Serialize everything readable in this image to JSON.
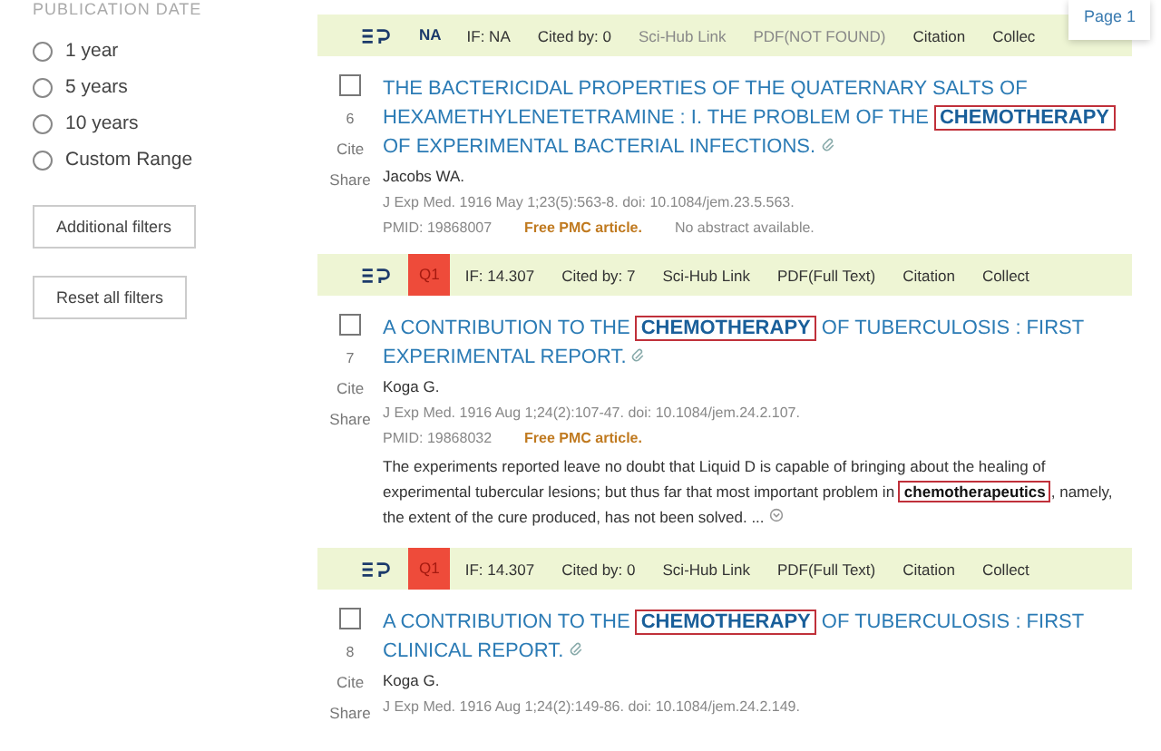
{
  "sidebar": {
    "section_title": "PUBLICATION DATE",
    "date_options": [
      {
        "label": "1 year",
        "selected": false
      },
      {
        "label": "5 years",
        "selected": false
      },
      {
        "label": "10 years",
        "selected": false
      },
      {
        "label": "Custom Range",
        "selected": false
      }
    ],
    "buttons": [
      "Additional filters",
      "Reset all filters"
    ]
  },
  "page_tag": "Page 1",
  "results": [
    {
      "toolbar": {
        "quartile": {
          "text": "NA",
          "kind": "plain"
        },
        "items": [
          {
            "text": "IF: NA",
            "disabled": false
          },
          {
            "text": "Cited by: 0",
            "disabled": false
          },
          {
            "text": "Sci-Hub Link",
            "disabled": true
          },
          {
            "text": "PDF(NOT FOUND)",
            "disabled": true
          },
          {
            "text": "Citation",
            "disabled": false
          },
          {
            "text": "Collec",
            "disabled": false
          }
        ]
      },
      "number": "6",
      "checked": false,
      "actions": [
        "Cite",
        "Share"
      ],
      "title_before": "THE BACTERICIDAL PROPERTIES OF THE QUATERNARY SALTS OF HEXAMETHYLENETETRAMINE : I. THE PROBLEM OF THE ",
      "title_highlight": "CHEMOTHERAPY",
      "title_after": " OF EXPERIMENTAL BACTERIAL INFECTIONS.",
      "authors": "Jacobs WA.",
      "citation": "J Exp Med. 1916 May 1;23(5):563-8. doi: 10.1084/jem.23.5.563.",
      "pmid": "PMID: 19868007",
      "free": "Free PMC article.",
      "note": "No abstract available."
    },
    {
      "toolbar": {
        "quartile": {
          "text": "Q1",
          "kind": "badge"
        },
        "items": [
          {
            "text": "IF: 14.307",
            "disabled": false
          },
          {
            "text": "Cited by: 7",
            "disabled": false
          },
          {
            "text": "Sci-Hub Link",
            "disabled": false
          },
          {
            "text": "PDF(Full Text)",
            "disabled": false
          },
          {
            "text": "Citation",
            "disabled": false
          },
          {
            "text": "Collect",
            "disabled": false
          }
        ]
      },
      "number": "7",
      "checked": false,
      "actions": [
        "Cite",
        "Share"
      ],
      "title_before": "A CONTRIBUTION TO THE ",
      "title_highlight": "CHEMOTHERAPY",
      "title_after": " OF TUBERCULOSIS : FIRST EXPERIMENTAL REPORT.",
      "authors": "Koga G.",
      "citation": "J Exp Med. 1916 Aug 1;24(2):107-47. doi: 10.1084/jem.24.2.107.",
      "pmid": "PMID: 19868032",
      "free": "Free PMC article.",
      "abstract_before": "The experiments reported leave no doubt that Liquid D is capable of bringing about the healing of experimental tubercular lesions; but thus far that most important problem in ",
      "abstract_highlight": "chemotherapeutics",
      "abstract_after": ", namely, the extent of the cure produced, has not been solved. ..."
    },
    {
      "toolbar": {
        "quartile": {
          "text": "Q1",
          "kind": "badge"
        },
        "items": [
          {
            "text": "IF: 14.307",
            "disabled": false
          },
          {
            "text": "Cited by: 0",
            "disabled": false
          },
          {
            "text": "Sci-Hub Link",
            "disabled": false
          },
          {
            "text": "PDF(Full Text)",
            "disabled": false
          },
          {
            "text": "Citation",
            "disabled": false
          },
          {
            "text": "Collect",
            "disabled": false
          }
        ]
      },
      "number": "8",
      "checked": false,
      "actions": [
        "Cite",
        "Share"
      ],
      "title_before": "A CONTRIBUTION TO THE ",
      "title_highlight": "CHEMOTHERAPY",
      "title_after": " OF TUBERCULOSIS : FIRST CLINICAL REPORT.",
      "authors": "Koga G.",
      "citation": "J Exp Med. 1916 Aug 1;24(2):149-86. doi: 10.1084/jem.24.2.149."
    }
  ]
}
